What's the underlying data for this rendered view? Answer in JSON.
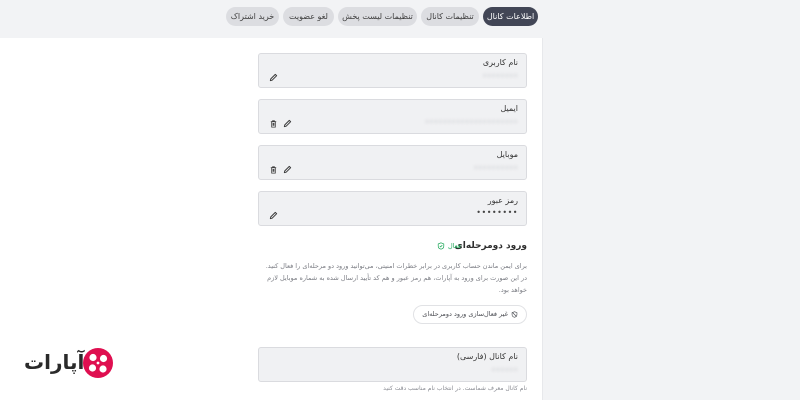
{
  "tabs": [
    {
      "label": "اطلاعات کانال",
      "active": true
    },
    {
      "label": "تنظیمات کانال",
      "active": false
    },
    {
      "label": "تنظیمات لیست پخش",
      "active": false
    },
    {
      "label": "لغو عضویت",
      "active": false
    },
    {
      "label": "خرید اشتراک",
      "active": false
    }
  ],
  "fields": {
    "username": {
      "label": "نام کاربری",
      "value": "••••••••"
    },
    "email": {
      "label": "ایمیل",
      "value": "•••••••••••••••••••••"
    },
    "mobile": {
      "label": "موبایل",
      "value": "••••••••••"
    },
    "password": {
      "label": "رمز عبور",
      "value": "••••••••"
    },
    "channel_name": {
      "label": "نام کانال (فارسی)",
      "value": "••••••"
    }
  },
  "twofa": {
    "title": "ورود دومرحله‌ای",
    "status": "فعال",
    "description": "برای ایمن ماندن حساب کاربری در برابر خطرات امنیتی، می‌توانید ورود دو مرحله‌ای را فعال کنید. در این صورت برای ورود به آپارات، هم رمز عبور و هم کد تأیید ارسال شده به شماره موبایل لازم خواهد بود.",
    "disable_label": "غیر فعال‌سازی ورود دومرحله‌ای"
  },
  "channel_hint": "نام کانال معرف شماست. در انتخاب نام مناسب دقت کنید",
  "brand": {
    "name": "آپارات",
    "color": "#df0f50"
  },
  "icons": [
    "edit-icon",
    "trash-icon",
    "shield-check-icon",
    "shield-off-icon",
    "aparat-logo-icon"
  ]
}
